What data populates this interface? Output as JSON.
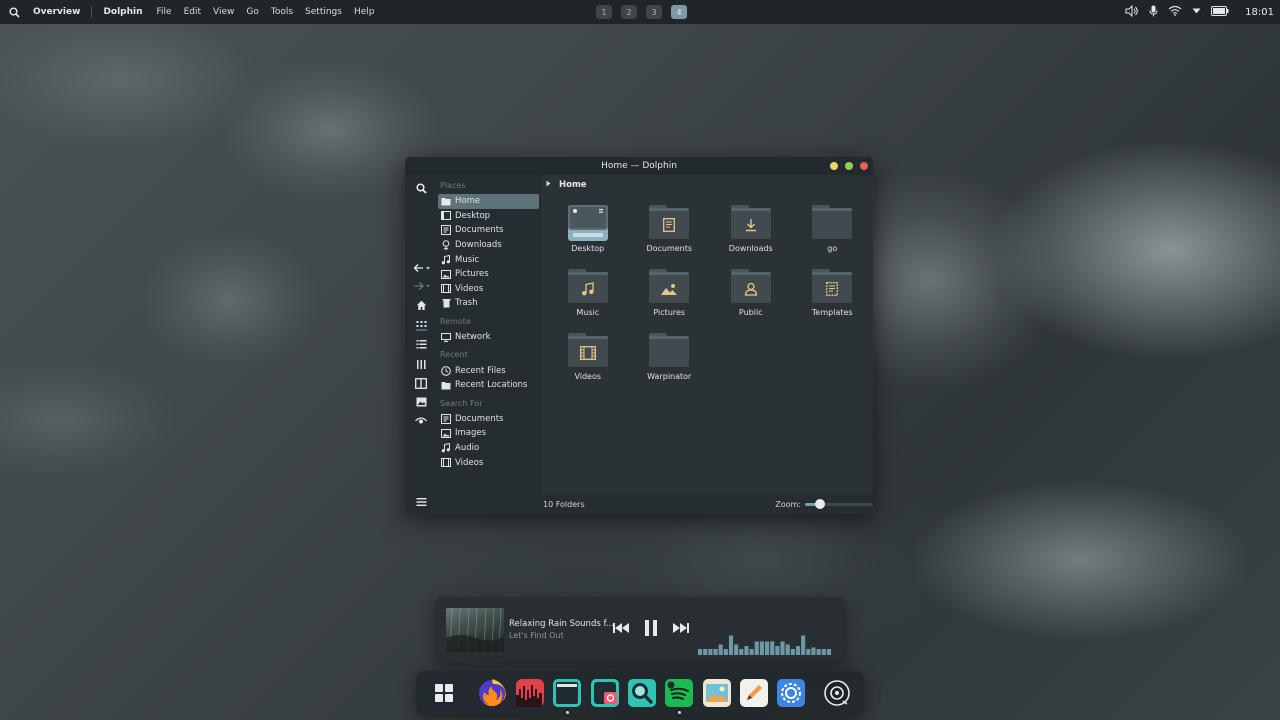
{
  "top_panel": {
    "overview_label": "Overview",
    "app_name": "Dolphin",
    "menu": [
      "File",
      "Edit",
      "View",
      "Go",
      "Tools",
      "Settings",
      "Help"
    ],
    "workspaces": [
      "1",
      "2",
      "3",
      "4"
    ],
    "active_workspace": "4",
    "clock": "18:01"
  },
  "window": {
    "title": "Home — Dolphin",
    "breadcrumb": "Home",
    "places": {
      "sections": [
        {
          "title": "Places",
          "items": [
            "Home",
            "Desktop",
            "Documents",
            "Downloads",
            "Music",
            "Pictures",
            "Videos",
            "Trash"
          ]
        },
        {
          "title": "Remote",
          "items": [
            "Network"
          ]
        },
        {
          "title": "Recent",
          "items": [
            "Recent Files",
            "Recent Locations"
          ]
        },
        {
          "title": "Search For",
          "items": [
            "Documents",
            "Images",
            "Audio",
            "Videos"
          ]
        }
      ],
      "active_item": "Home"
    },
    "folders": [
      "Desktop",
      "Documents",
      "Downloads",
      "go",
      "Music",
      "Pictures",
      "Public",
      "Templates",
      "Videos",
      "Warpinator"
    ],
    "status": "10 Folders",
    "zoom_label": "Zoom:",
    "zoom_level": 0.22
  },
  "player": {
    "title": "Relaxing Rain Sounds f...",
    "artist": "Let's Find Out",
    "visualizer_levels": [
      0.2,
      0.2,
      0.2,
      0.2,
      0.35,
      0.2,
      0.65,
      0.35,
      0.2,
      0.3,
      0.2,
      0.45,
      0.45,
      0.45,
      0.45,
      0.3,
      0.45,
      0.35,
      0.2,
      0.3,
      0.65,
      0.2,
      0.25,
      0.2,
      0.2,
      0.2
    ]
  },
  "dock": {
    "apps": [
      "app-grid",
      "firefox",
      "audio-editor",
      "files",
      "screenshot",
      "search",
      "spotify",
      "image-viewer",
      "text-editor",
      "settings",
      "music-player"
    ]
  },
  "colors": {
    "accent": "#6fa4b3",
    "selection": "#5d7279",
    "folder_glyph": "#e6c58a",
    "close": "#ee5a5a",
    "maximize": "#8fd14f",
    "minimize": "#f1d36a"
  }
}
